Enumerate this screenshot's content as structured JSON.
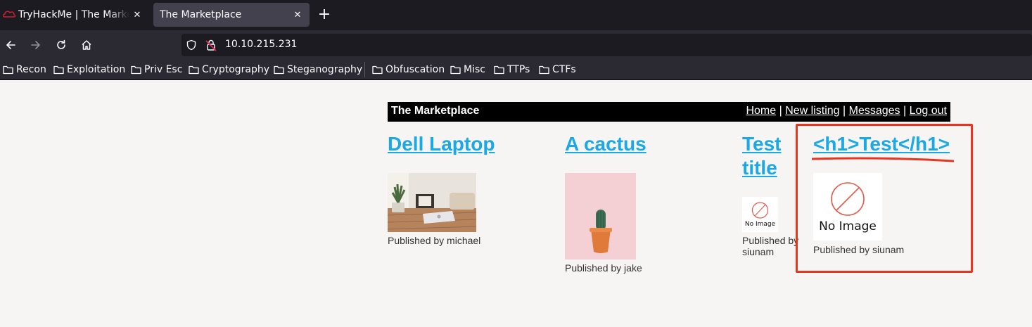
{
  "browser": {
    "tabs": [
      {
        "title": "TryHackMe | The Marketplace",
        "active": false
      },
      {
        "title": "The Marketplace",
        "active": true
      }
    ],
    "url": "10.10.215.231",
    "bookmarks": [
      "Recon",
      "Exploitation",
      "Priv Esc",
      "Cryptography",
      "Steganography",
      "Obfuscation",
      "Misc",
      "TTPs",
      "CTFs"
    ],
    "icons": {
      "tab_close": "close-icon",
      "new_tab": "plus-icon",
      "back": "arrow-left-icon",
      "forward": "arrow-right-icon",
      "reload": "reload-icon",
      "home": "home-icon",
      "tracking": "shield-icon",
      "insecure": "broken-lock-icon",
      "bookmark": "folder-icon"
    }
  },
  "site": {
    "title": "The Marketplace",
    "nav": {
      "home": "Home",
      "new_listing": "New listing",
      "messages": "Messages",
      "logout": "Log out",
      "separator": "|"
    },
    "listings": [
      {
        "title": "Dell Laptop",
        "author": "Published by michael",
        "image": "laptop-photo"
      },
      {
        "title": "A cactus",
        "author": "Published by jake",
        "image": "cactus-photo"
      },
      {
        "title": "Test title",
        "author": "Published by siunam",
        "image": "no-image-placeholder",
        "image_text": "No Image"
      },
      {
        "title": "<h1>Test</h1>",
        "author": "Published by siunam",
        "image": "no-image-placeholder",
        "image_text": "No Image"
      }
    ]
  },
  "colors": {
    "link": "#1ba8e6",
    "annotation": "#e8351f",
    "header_bg": "#000000",
    "page_bg": "#f6f5f3",
    "chrome_dark": "#1c1b22",
    "chrome": "#2b2a33"
  }
}
